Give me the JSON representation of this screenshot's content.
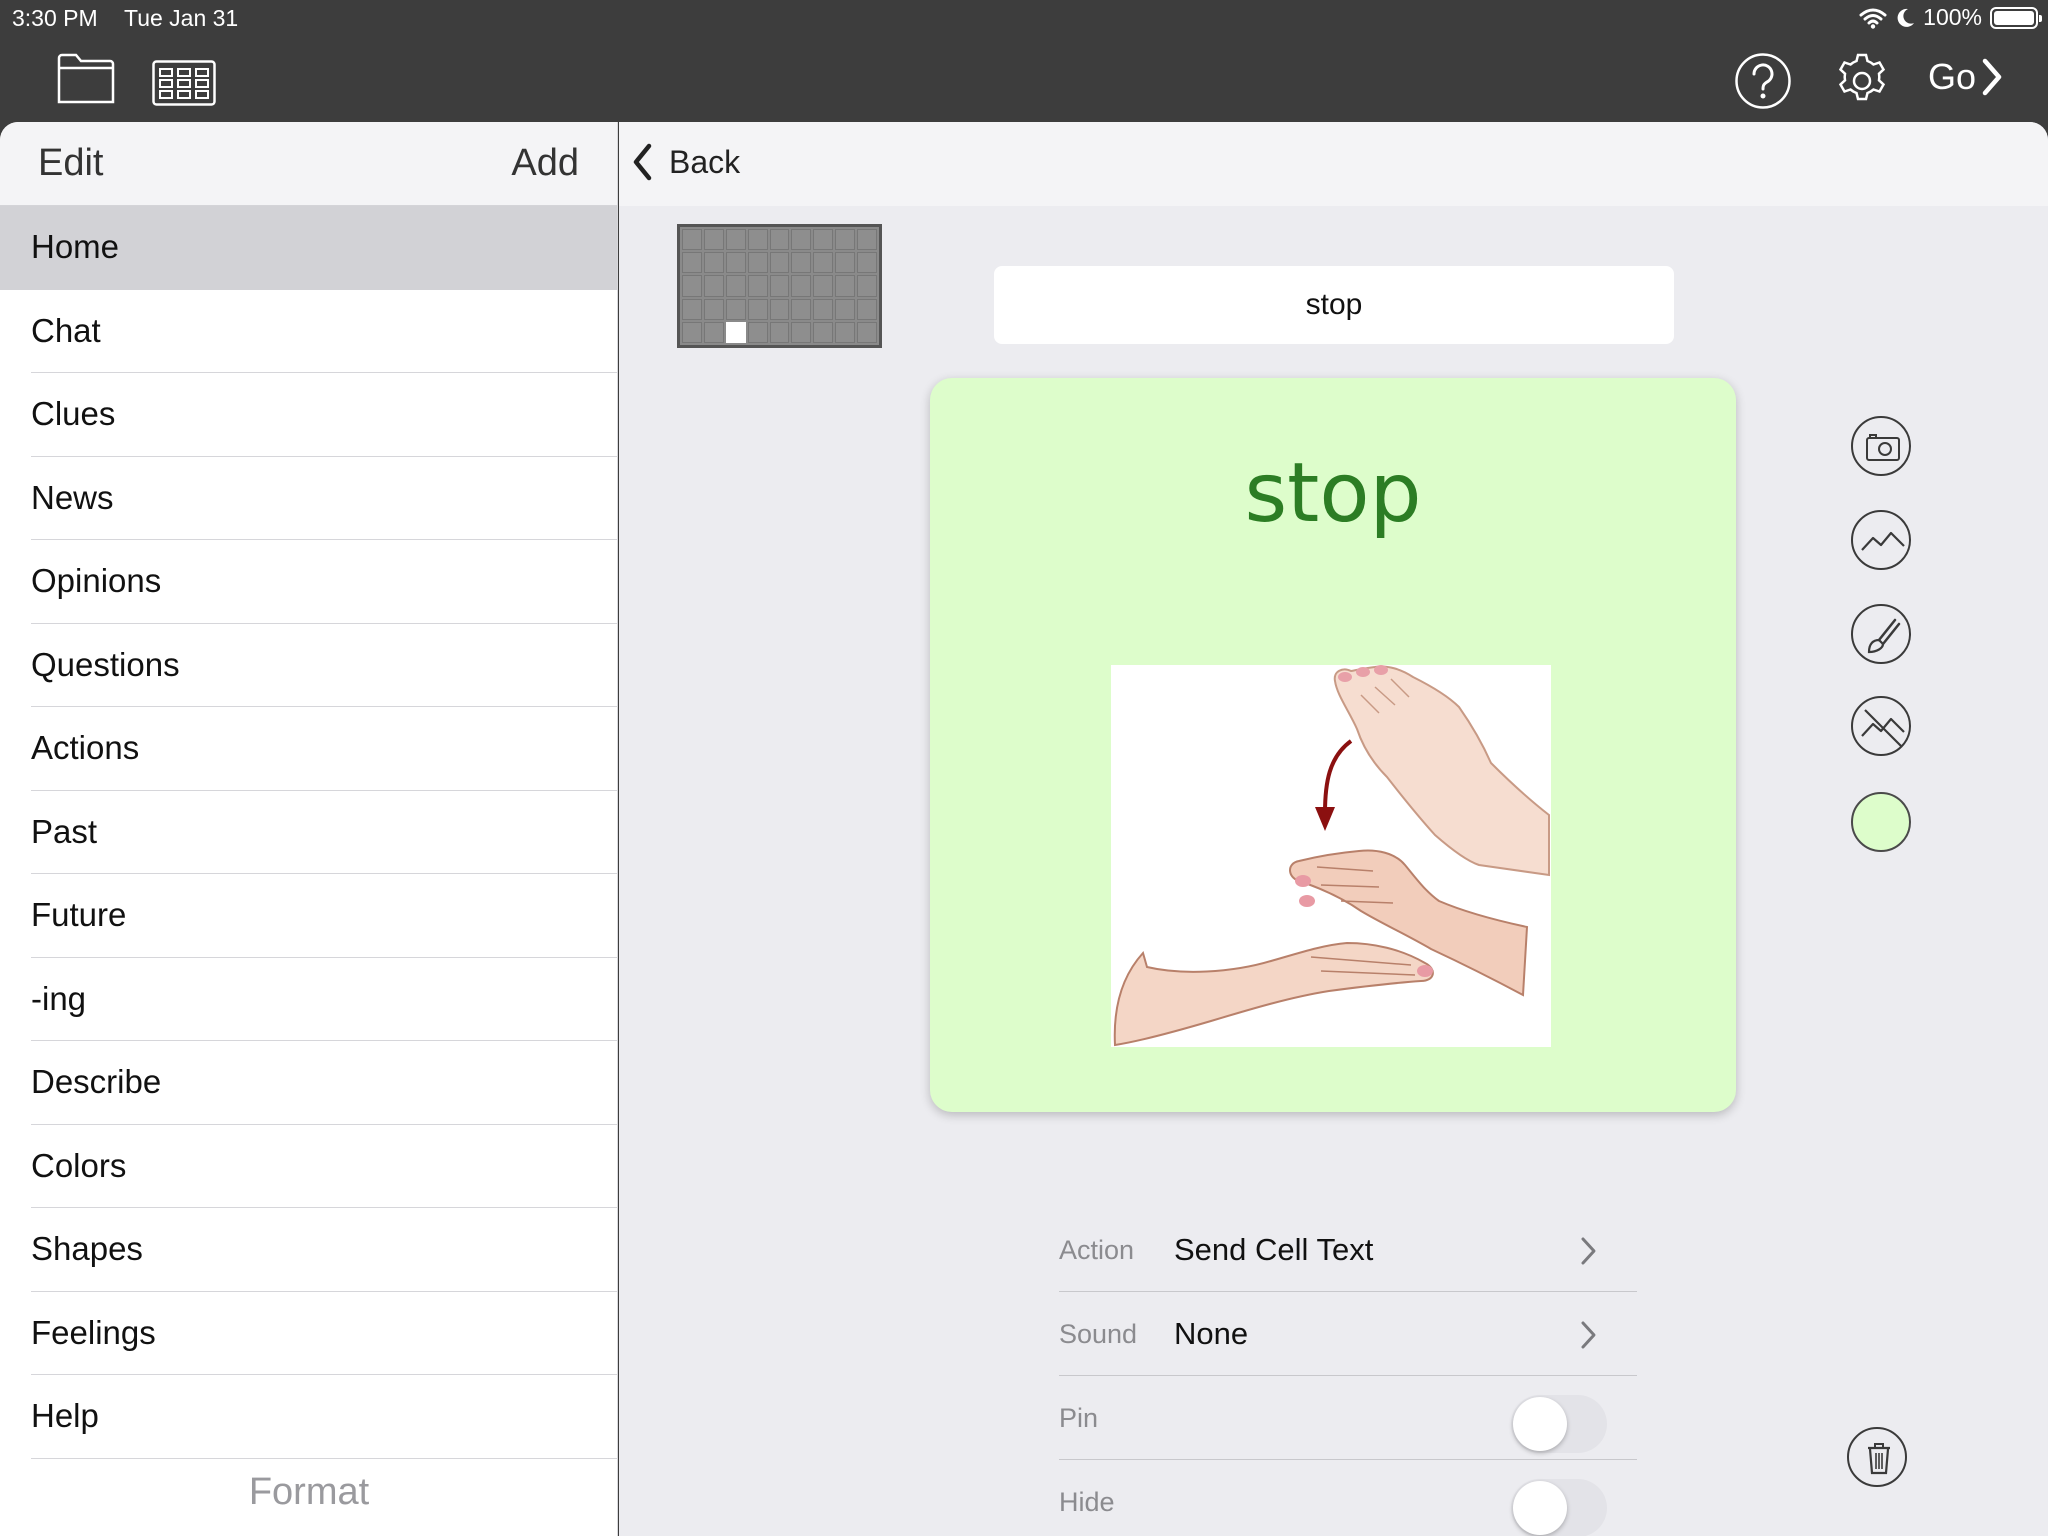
{
  "status_bar": {
    "time": "3:30 PM",
    "date": "Tue Jan 31",
    "battery": "100%"
  },
  "toolbar": {
    "go_label": "Go"
  },
  "sidebar": {
    "edit_label": "Edit",
    "add_label": "Add",
    "items": [
      "Home",
      "Chat",
      "Clues",
      "News",
      "Opinions",
      "Questions",
      "Actions",
      "Past",
      "Future",
      "-ing",
      "Describe",
      "Colors",
      "Shapes",
      "Feelings",
      "Help"
    ],
    "selected": "Home",
    "format_label": "Format"
  },
  "main": {
    "back_label": "Back",
    "cell_label_value": "stop",
    "cell": {
      "text": "stop",
      "background_color": "#ddfdcb",
      "text_color": "#2c7d24",
      "image": "sign-language-stop-hands"
    },
    "properties": [
      {
        "label": "Action",
        "value": "Send Cell Text"
      },
      {
        "label": "Sound",
        "value": "None"
      },
      {
        "label": "Pin",
        "toggle": false
      },
      {
        "label": "Hide",
        "toggle": false
      }
    ],
    "tools": [
      "camera-icon",
      "photo-library-icon",
      "draw-icon",
      "remove-image-icon",
      "cell-color-swatch"
    ]
  }
}
